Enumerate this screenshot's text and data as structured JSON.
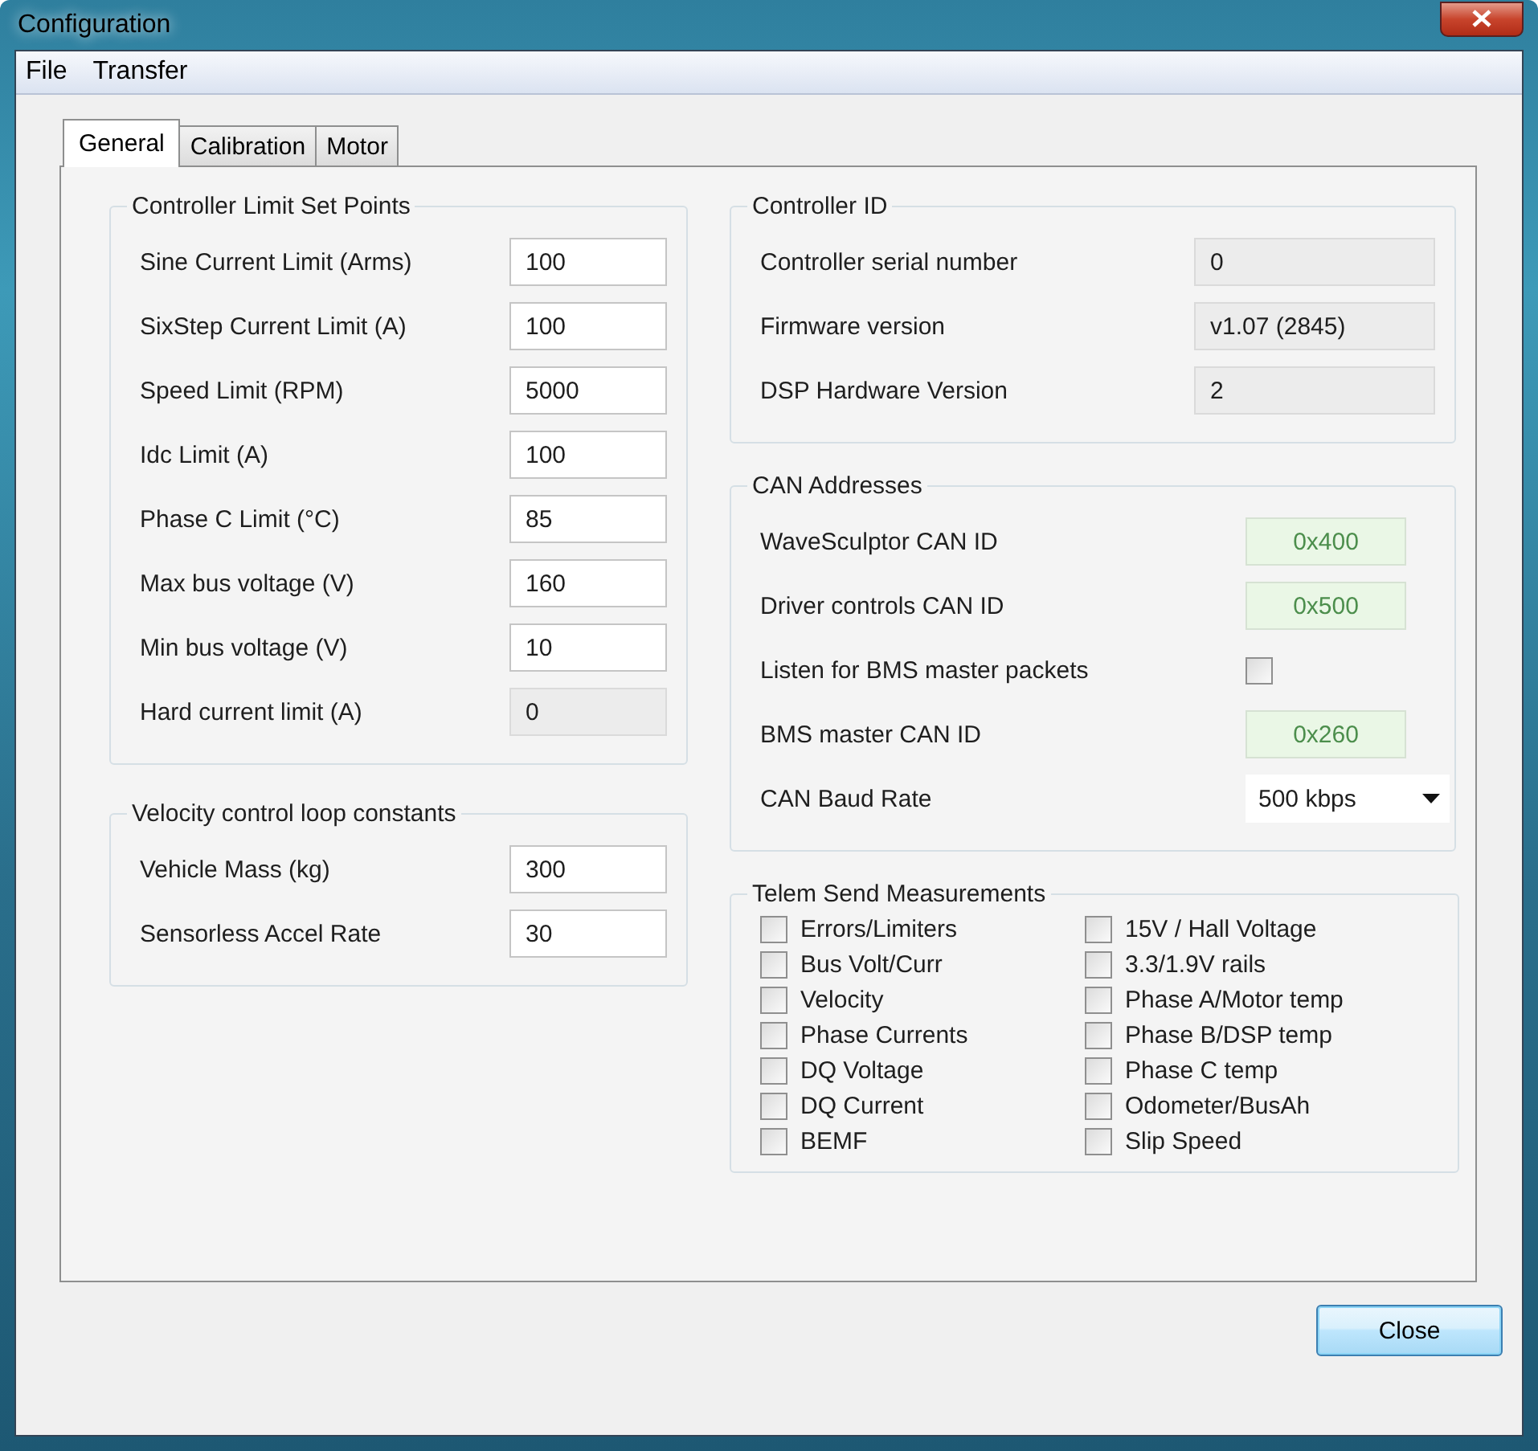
{
  "window": {
    "title": "Configuration"
  },
  "menu": [
    {
      "label": "File"
    },
    {
      "label": "Transfer"
    }
  ],
  "tabs": [
    {
      "label": "General",
      "selected": true
    },
    {
      "label": "Calibration",
      "selected": false
    },
    {
      "label": "Motor",
      "selected": false
    }
  ],
  "limit_set_points": {
    "title": "Controller Limit Set Points",
    "fields": [
      {
        "label": "Sine Current Limit (Arms)",
        "value": "100",
        "readonly": false
      },
      {
        "label": "SixStep Current Limit (A)",
        "value": "100",
        "readonly": false
      },
      {
        "label": "Speed Limit (RPM)",
        "value": "5000",
        "readonly": false
      },
      {
        "label": "Idc Limit (A)",
        "value": "100",
        "readonly": false
      },
      {
        "label": "Phase C Limit (°C)",
        "value": "85",
        "readonly": false
      },
      {
        "label": "Max bus voltage (V)",
        "value": "160",
        "readonly": false
      },
      {
        "label": "Min bus voltage (V)",
        "value": "10",
        "readonly": false
      },
      {
        "label": "Hard current limit (A)",
        "value": "0",
        "readonly": true
      }
    ]
  },
  "velocity_loop": {
    "title": "Velocity control loop constants",
    "fields": [
      {
        "label": "Vehicle Mass  (kg)",
        "value": "300",
        "readonly": false
      },
      {
        "label": "Sensorless Accel Rate",
        "value": "30",
        "readonly": false
      }
    ]
  },
  "controller_id": {
    "title": "Controller ID",
    "fields": [
      {
        "label": "Controller serial number",
        "value": "0",
        "readonly": true
      },
      {
        "label": "Firmware version",
        "value": "v1.07 (2845)",
        "readonly": true
      },
      {
        "label": "DSP Hardware Version",
        "value": "2",
        "readonly": true
      }
    ]
  },
  "can_addresses": {
    "title": "CAN Addresses",
    "rows": [
      {
        "kind": "id",
        "label": "WaveSculptor CAN ID",
        "value": "0x400"
      },
      {
        "kind": "id",
        "label": "Driver controls CAN ID",
        "value": "0x500"
      },
      {
        "kind": "checkbox",
        "label": "Listen for BMS master packets",
        "checked": false
      },
      {
        "kind": "id",
        "label": "BMS master CAN ID",
        "value": "0x260"
      },
      {
        "kind": "dropdown",
        "label": "CAN Baud Rate",
        "value": "500 kbps"
      }
    ]
  },
  "telem_send": {
    "title": "Telem Send Measurements",
    "columns": [
      [
        {
          "label": "Errors/Limiters",
          "checked": false
        },
        {
          "label": "Bus Volt/Curr",
          "checked": false
        },
        {
          "label": "Velocity",
          "checked": false
        },
        {
          "label": "Phase Currents",
          "checked": false
        },
        {
          "label": "DQ Voltage",
          "checked": false
        },
        {
          "label": "DQ Current",
          "checked": false
        },
        {
          "label": "BEMF",
          "checked": false
        }
      ],
      [
        {
          "label": "15V / Hall Voltage",
          "checked": false
        },
        {
          "label": "3.3/1.9V rails",
          "checked": false
        },
        {
          "label": "Phase A/Motor temp",
          "checked": false
        },
        {
          "label": "Phase B/DSP temp",
          "checked": false
        },
        {
          "label": "Phase C temp",
          "checked": false
        },
        {
          "label": "Odometer/BusAh",
          "checked": false
        },
        {
          "label": "Slip Speed",
          "checked": false
        }
      ]
    ]
  },
  "buttons": [
    {
      "label": "Close"
    }
  ]
}
